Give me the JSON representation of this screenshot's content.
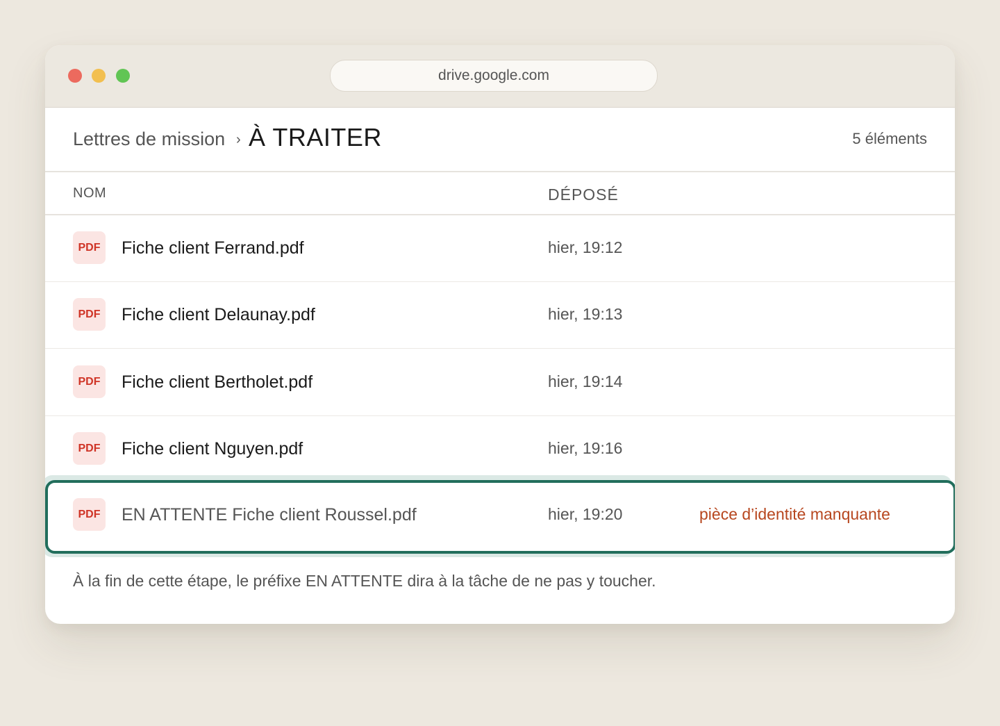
{
  "browser": {
    "url": "drive.google.com"
  },
  "header": {
    "breadcrumb_parent": "Lettres de mission",
    "breadcrumb_separator": "›",
    "breadcrumb_current": "À TRAITER",
    "item_count": "5 éléments"
  },
  "columns": {
    "name": "NOM",
    "date": "DÉPOSÉ"
  },
  "files": [
    {
      "icon": "PDF",
      "name": "Fiche client Ferrand.pdf",
      "date": "hier, 19:12"
    },
    {
      "icon": "PDF",
      "name": "Fiche client Delaunay.pdf",
      "date": "hier, 19:13"
    },
    {
      "icon": "PDF",
      "name": "Fiche client Bertholet.pdf",
      "date": "hier, 19:14"
    },
    {
      "icon": "PDF",
      "name": "Fiche client Nguyen.pdf",
      "date": "hier, 19:16"
    },
    {
      "icon": "PDF",
      "name": "EN ATTENTE Fiche client Roussel.pdf",
      "date": "hier, 19:20",
      "note": "pièce d’identité manquante"
    }
  ],
  "footer": {
    "text": "À la fin de cette étape, le préfixe EN ATTENTE dira à la tâche de ne pas y toucher."
  },
  "colors": {
    "highlight_border": "#226e5c",
    "note_text": "#b7471f",
    "pdf_icon_text": "#cf3426",
    "pdf_icon_bg": "#fbe5e3"
  }
}
